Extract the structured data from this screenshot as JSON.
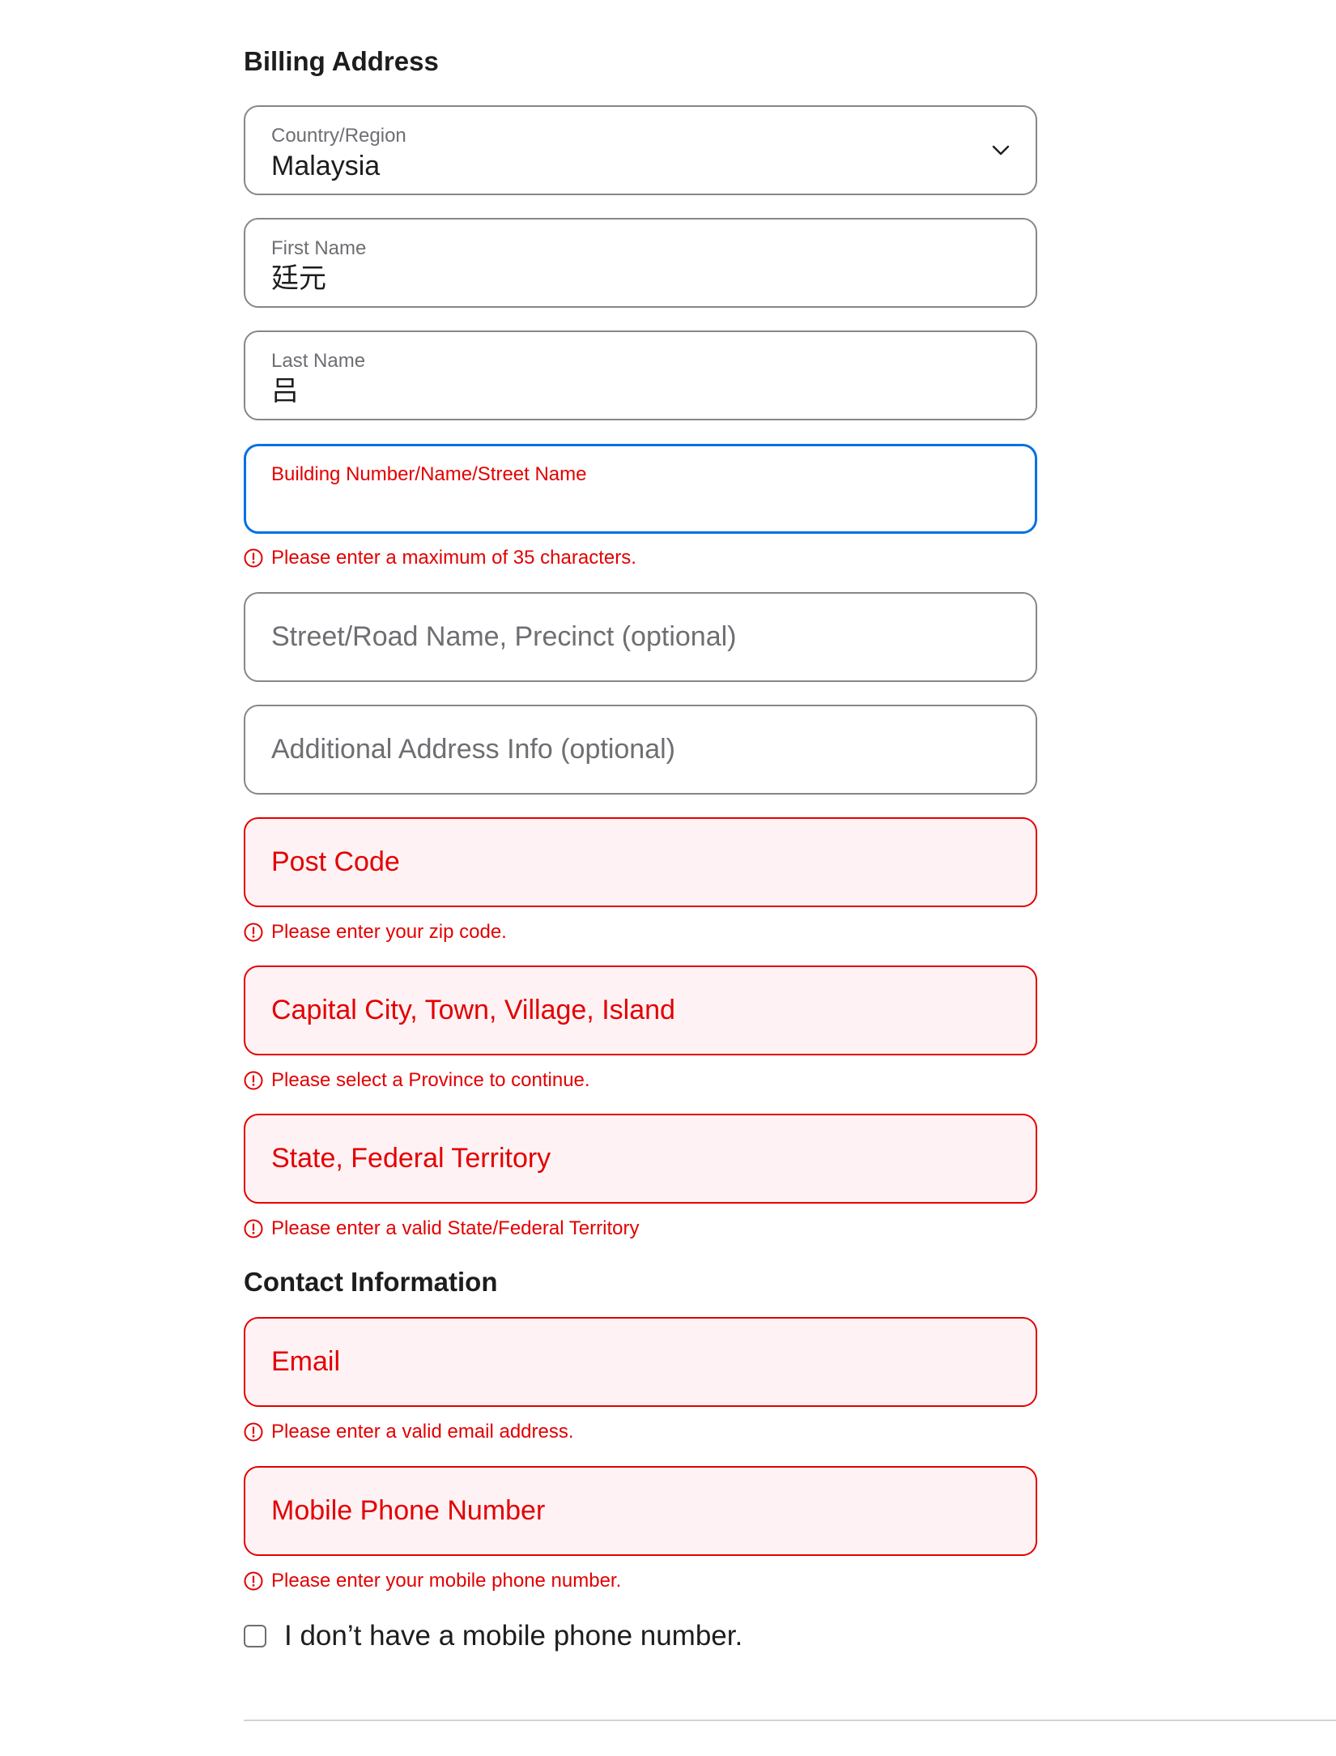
{
  "billing": {
    "title": "Billing Address",
    "country": {
      "label": "Country/Region",
      "value": "Malaysia",
      "icon": "chevron-down-icon"
    },
    "first_name": {
      "label": "First Name",
      "value": "廷元"
    },
    "last_name": {
      "label": "Last Name",
      "value": "吕"
    },
    "street1": {
      "label": "Building Number/Name/Street Name",
      "value": "",
      "error": "Please enter a maximum of 35 characters."
    },
    "street2": {
      "placeholder": "Street/Road Name, Precinct (optional)"
    },
    "street3": {
      "placeholder": "Additional Address Info (optional)"
    },
    "postcode": {
      "placeholder": "Post Code",
      "error": "Please enter your zip code."
    },
    "city": {
      "placeholder": "Capital City, Town, Village, Island",
      "error": "Please select a Province to continue."
    },
    "state": {
      "placeholder": "State, Federal Territory",
      "error": "Please enter a valid State/Federal Territory"
    }
  },
  "contact": {
    "title": "Contact Information",
    "email": {
      "placeholder": "Email",
      "error": "Please enter a valid email address."
    },
    "phone": {
      "placeholder": "Mobile Phone Number",
      "error": "Please enter your mobile phone number."
    },
    "no_phone": {
      "label": "I don’t have a mobile phone number.",
      "checked": false
    }
  },
  "colors": {
    "error": "#e30000",
    "error_bg": "#fff2f4",
    "focus": "#0071e3",
    "border": "#86868b",
    "text": "#1d1d1f",
    "muted": "#6e6e73"
  }
}
